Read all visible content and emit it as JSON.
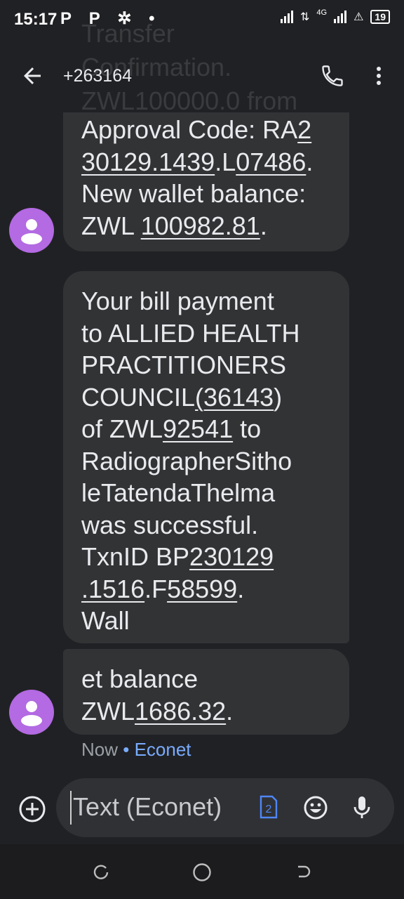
{
  "status_bar": {
    "time": "15:17",
    "left_icons": [
      "P",
      "P"
    ],
    "network_label": "4G",
    "battery": "19"
  },
  "app_bar": {
    "title": "+263164",
    "back_icon": "arrow-back-icon",
    "call_icon": "phone-icon",
    "more_icon": "more-vert-icon"
  },
  "faded_text": {
    "line1": "Transfer",
    "line2": "Confirmation.",
    "line3": "ZWL100000.0 from"
  },
  "messages": {
    "m1": {
      "l1a": "Approval Code: RA",
      "l1b": "2",
      "l2a": "30129.1439",
      "l2b": ".L",
      "l2c": "07486",
      "l2d": ".",
      "l3": "New wallet balance:",
      "l4a": "ZWL ",
      "l4b": "100982.81",
      "l4c": "."
    },
    "m2": {
      "l1": "Your bill payment",
      "l2": "to ALLIED HEALTH",
      "l3": "PRACTITIONERS",
      "l4a": "COUNCIL",
      "l4b": "(36143",
      "l4c": ")",
      "l5a": "of ZWL",
      "l5b": "92541",
      "l5c": " to",
      "l6": "RadiographerSitho",
      "l7": "leTatendaThelma",
      "l8": "was successful.",
      "l9a": "TxnID BP",
      "l9b": "230129",
      "l10a": ".1516",
      "l10b": ".F",
      "l10c": "58599",
      "l10d": ".",
      "l11": "Wall"
    },
    "m3": {
      "l1": "et balance",
      "l2a": "ZWL",
      "l2b": "1686.32",
      "l2c": "."
    }
  },
  "meta": {
    "time": "Now",
    "separator": " • ",
    "network": "Econet"
  },
  "composer": {
    "placeholder": "Text (Econet)",
    "sim_badge": "2"
  },
  "colors": {
    "background": "#202124",
    "bubble": "#323335",
    "avatar": "#b36ae2",
    "accent": "#7aacff"
  }
}
